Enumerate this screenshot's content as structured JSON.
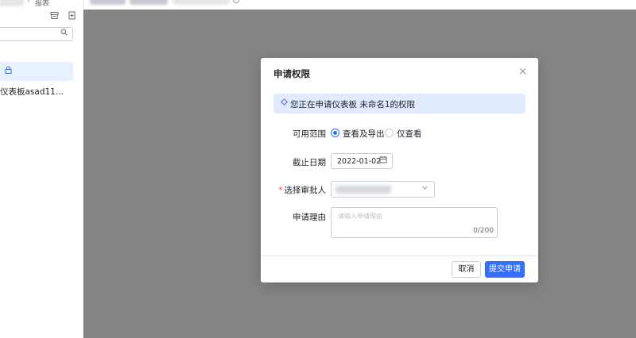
{
  "sidebar": {
    "breadcrumb_text": "报表",
    "search": {
      "placeholder": ""
    },
    "items": [
      {
        "label": ""
      },
      {
        "label": "仪表板asad11..."
      }
    ]
  },
  "dialog": {
    "title": "申请权限",
    "notice": "您正在申请仪表板 未命名1的权限",
    "scope": {
      "label": "可用范围",
      "options": [
        {
          "label": "查看及导出",
          "checked": true
        },
        {
          "label": "仅查看",
          "checked": false
        }
      ]
    },
    "deadline": {
      "label": "截止日期",
      "value": "2022-01-02"
    },
    "approver": {
      "required_mark": "*",
      "label": "选择审批人",
      "value": ""
    },
    "reason": {
      "label": "申请理由",
      "placeholder": "请输入申请理由",
      "counter": "0/200"
    },
    "buttons": {
      "cancel": "取消",
      "submit": "提交申请"
    }
  },
  "colors": {
    "accent": "#3370ff",
    "overlay": "#848484",
    "notice_bg": "#e1eaff",
    "required": "#f54a45"
  }
}
